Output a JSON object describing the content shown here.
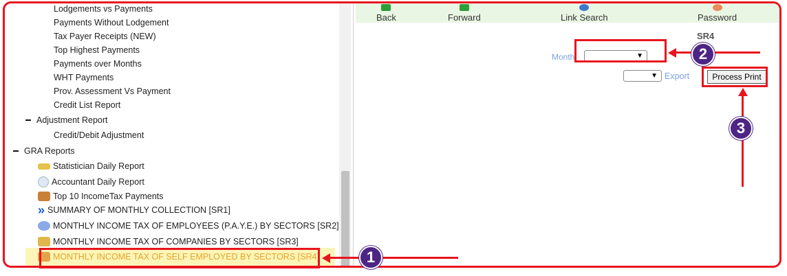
{
  "tree": {
    "sub_items_top": [
      "Lodgements vs Payments",
      "Payments Without Lodgement",
      "Tax Payer Receipts (NEW)",
      "Top Highest Payments",
      "Payments over Months",
      "WHT Payments",
      "Prov. Assessment Vs Payment",
      "Credit List Report"
    ],
    "adjustment_section": "Adjustment Report",
    "adjustment_item": "Credit/Debit Adjustment",
    "gra_section": "GRA Reports",
    "gra_reports": [
      "Statistician Daily Report",
      "Accountant Daily Report",
      "Top 10 IncomeTax Payments",
      "SUMMARY OF MONTHLY COLLECTION [SR1]",
      "MONTHLY INCOME TAX OF EMPLOYEES (P.A.Y.E.) BY SECTORS [SR2]",
      "MONTHLY INCOME TAX OF COMPANIES BY SECTORS [SR3]"
    ],
    "selected_report": "MONTHLY INCOME TAX OF SELF EMPLOYED BY SECTORS [SR4]"
  },
  "toolbar": {
    "back": "Back",
    "forward": "Forward",
    "link_search": "Link Search",
    "password": "Password"
  },
  "report": {
    "code": "SR4",
    "month_label": "Month",
    "month_value": "",
    "export_format": "",
    "export_label": "Export",
    "process_print": "Process Print"
  },
  "callouts": [
    "1",
    "2",
    "3"
  ],
  "colors": {
    "callout_red": "#e8141e",
    "badge_purple": "#4d2585",
    "link_blue": "#7ba3e3",
    "toolbar_bg": "#e9f6e3",
    "selected_text": "#e8a12a",
    "selected_bg": "#fbf6b8"
  }
}
